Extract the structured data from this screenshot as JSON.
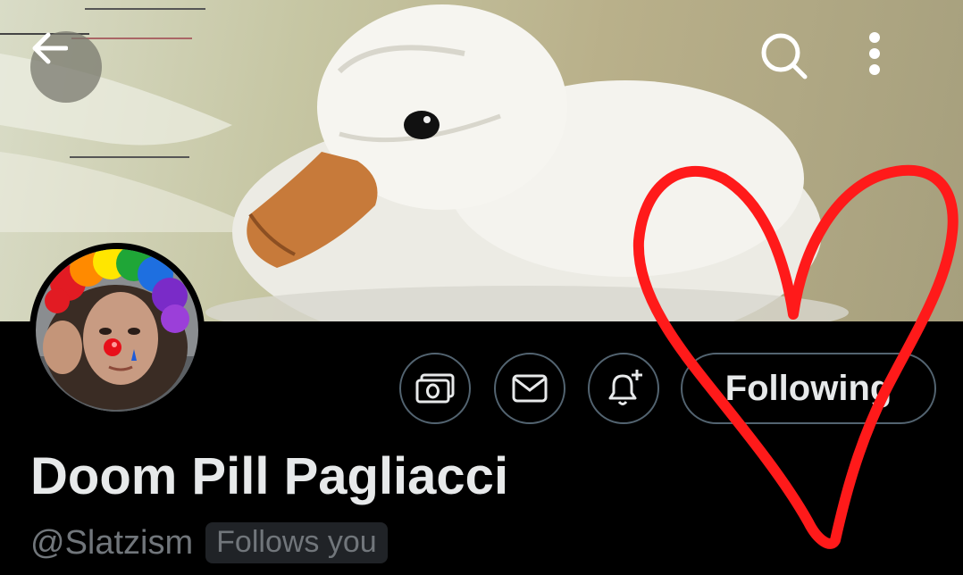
{
  "header": {
    "back_icon": "arrow-left-icon",
    "search_icon": "search-icon",
    "more_icon": "more-vertical-icon"
  },
  "profile": {
    "display_name": "Doom Pill Pagliacci",
    "handle": "@Slatzism",
    "follows_you_label": "Follows you"
  },
  "actions": {
    "tip_icon": "money-icon",
    "message_icon": "envelope-icon",
    "notify_icon": "bell-plus-icon",
    "following_label": "Following"
  },
  "colors": {
    "background": "#000000",
    "text_primary": "#e7e9ea",
    "text_secondary": "#71767b",
    "button_border": "#536471",
    "heart_overlay": "#ff1a1a"
  }
}
